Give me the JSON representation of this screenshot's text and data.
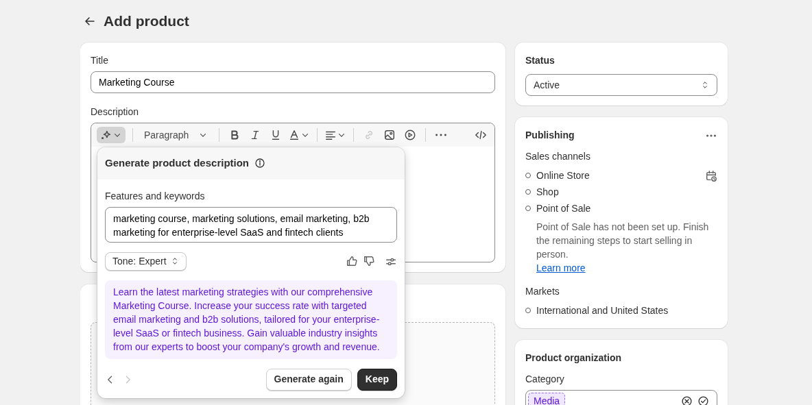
{
  "page": {
    "title": "Add product"
  },
  "title_card": {
    "title_label": "Title",
    "title_value": "Marketing Course",
    "description_label": "Description",
    "toolbar": {
      "ai_selected": true,
      "paragraph": "Paragraph",
      "link_disabled": true
    }
  },
  "generator": {
    "title": "Generate product description",
    "keywords_label": "Features and keywords",
    "keywords_value": "marketing course, marketing solutions, email marketing, b2b marketing for enterprise-level SaaS and fintech clients",
    "tone": "Tone: Expert",
    "result": "Learn the latest marketing strategies with our comprehensive Marketing Course. Increase your success rate with targeted email marketing and b2b solutions, tailored for your enterprise-level SaaS or fintech business. Gain valuable industry insights from our experts to boost your company's growth and revenue.",
    "prev_disabled": false,
    "next_disabled": true,
    "buttons": [
      {
        "label": "Generate again",
        "kind": "secondary"
      },
      {
        "label": "Keep",
        "kind": "primary"
      }
    ]
  },
  "status": {
    "label": "Status",
    "value": "Active"
  },
  "publishing": {
    "title": "Publishing",
    "sales_channels_label": "Sales channels",
    "channels": [
      {
        "name": "Online Store",
        "scheduled": true
      },
      {
        "name": "Shop",
        "scheduled": false
      },
      {
        "name": "Point of Sale",
        "scheduled": false,
        "note": "Point of Sale has not been set up. Finish the remaining steps to start selling in person.",
        "link": "Learn more"
      }
    ],
    "markets_label": "Markets",
    "markets": [
      {
        "name": "International and United States"
      }
    ]
  },
  "organization": {
    "title": "Product organization",
    "category_label": "Category",
    "category_tag": "Media"
  }
}
